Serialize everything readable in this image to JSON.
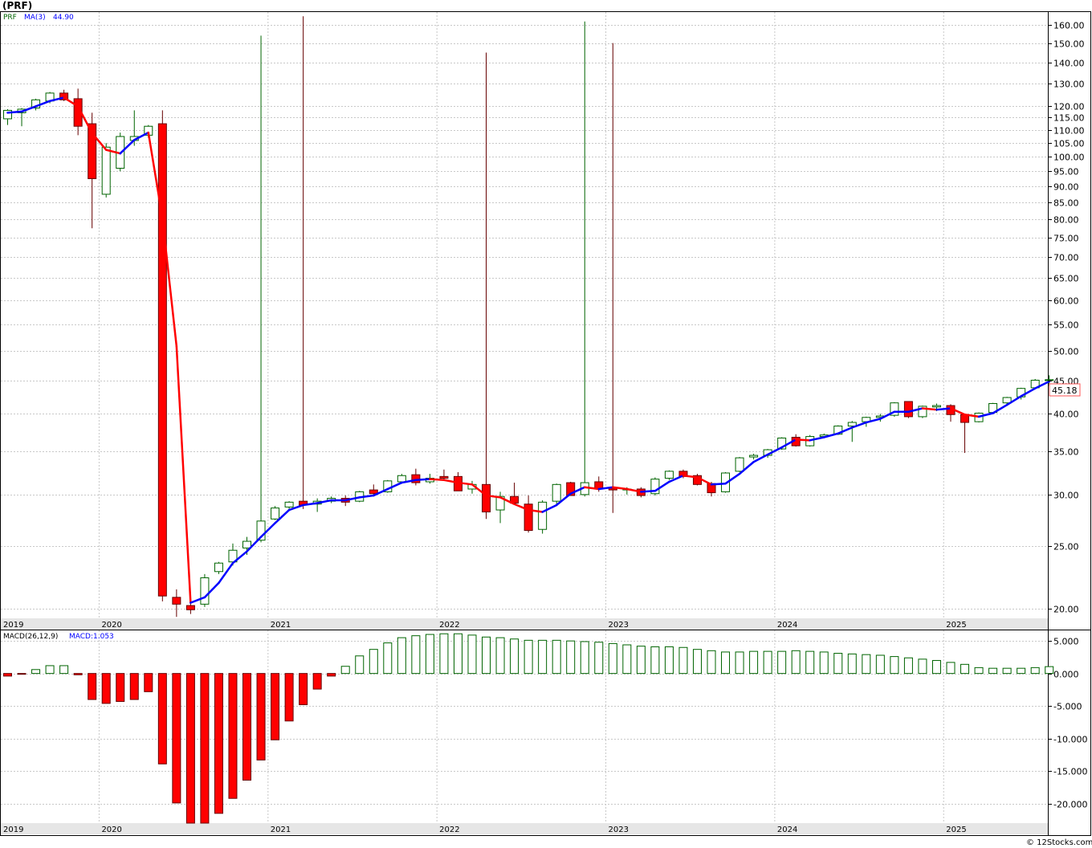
{
  "header": {
    "title": "(PRF)"
  },
  "legend": {
    "symbol": "PRF",
    "ma_label": "MA(3)",
    "ma_value": "44.90",
    "macd_label": "MACD(26,12,9)",
    "macd_value": "MACD:1.053"
  },
  "credit": "© 12Stocks.com",
  "last_price_label": "45.18",
  "colors": {
    "up": "#006400",
    "down_fill": "#ff0000",
    "down_wick": "#660000",
    "ma_up": "#0000ff",
    "ma_down": "#ff0000",
    "grid": "#c8c8c8",
    "year_band": "#e6e6e6",
    "last_box": "#ff5555"
  },
  "year_labels": [
    "2019",
    "2020",
    "2021",
    "2022",
    "2023",
    "2024",
    "2025"
  ],
  "price_ticks": [
    "160.00",
    "150.00",
    "140.00",
    "130.00",
    "120.00",
    "115.00",
    "110.00",
    "105.00",
    "100.00",
    "95.00",
    "90.00",
    "85.00",
    "80.00",
    "75.00",
    "70.00",
    "65.00",
    "60.00",
    "55.00",
    "50.00",
    "45.00",
    "40.00",
    "35.00",
    "30.00",
    "25.00",
    "20.00"
  ],
  "macd_ticks": [
    "5.000",
    "0.000",
    "-5.000",
    "-10.000",
    "-15.000",
    "-20.000"
  ],
  "chart_data": [
    {
      "type": "candlestick",
      "title": "(PRF)",
      "scale": "log",
      "ylim": [
        19.3,
        168
      ],
      "x_range": [
        "2019-06",
        "2025-11"
      ],
      "candles": [
        {
          "t": "2019-06",
          "o": 114.5,
          "h": 118.5,
          "l": 112,
          "c": 118
        },
        {
          "t": "2019-07",
          "o": 117,
          "h": 119,
          "l": 111.5,
          "c": 118.5
        },
        {
          "t": "2019-08",
          "o": 119,
          "h": 123,
          "l": 118,
          "c": 122.5
        },
        {
          "t": "2019-09",
          "o": 122,
          "h": 126,
          "l": 121,
          "c": 125.5
        },
        {
          "t": "2019-10",
          "o": 125.5,
          "h": 127,
          "l": 122,
          "c": 122.5
        },
        {
          "t": "2019-11",
          "o": 123,
          "h": 127.5,
          "l": 108,
          "c": 111.5
        },
        {
          "t": "2019-12",
          "o": 112.5,
          "h": 117,
          "l": 77.5,
          "c": 92.5
        },
        {
          "t": "2020-01",
          "o": 87.5,
          "h": 105,
          "l": 86.5,
          "c": 103.5
        },
        {
          "t": "2020-02",
          "o": 96,
          "h": 109,
          "l": 95,
          "c": 107.5
        },
        {
          "t": "2020-03",
          "o": 106,
          "h": 118,
          "l": 104,
          "c": 107.5
        },
        {
          "t": "2020-04",
          "o": 108,
          "h": 112,
          "l": 107,
          "c": 111.5
        },
        {
          "t": "2020-05",
          "o": 112.5,
          "h": 118,
          "l": 20.5,
          "c": 20.9
        },
        {
          "t": "2020-06",
          "o": 20.8,
          "h": 21.4,
          "l": 19.4,
          "c": 20.3
        },
        {
          "t": "2020-07",
          "o": 20.2,
          "h": 20.5,
          "l": 19.6,
          "c": 19.9
        },
        {
          "t": "2020-08",
          "o": 20.3,
          "h": 22.6,
          "l": 20.1,
          "c": 22.3
        },
        {
          "t": "2020-09",
          "o": 22.8,
          "h": 23.6,
          "l": 22.6,
          "c": 23.5
        },
        {
          "t": "2020-10",
          "o": 23.6,
          "h": 25.2,
          "l": 23.3,
          "c": 24.6
        },
        {
          "t": "2020-11",
          "o": 24.8,
          "h": 25.8,
          "l": 24.2,
          "c": 25.4
        },
        {
          "t": "2020-12",
          "o": 25.5,
          "h": 154,
          "l": 25.3,
          "c": 27.3
        },
        {
          "t": "2021-01",
          "o": 27.5,
          "h": 28.8,
          "l": 27.4,
          "c": 28.6
        },
        {
          "t": "2021-02",
          "o": 28.7,
          "h": 29.3,
          "l": 28.5,
          "c": 29.2
        },
        {
          "t": "2021-03",
          "o": 29.3,
          "h": 165,
          "l": 28.5,
          "c": 28.9
        },
        {
          "t": "2021-04",
          "o": 29,
          "h": 29.6,
          "l": 28.2,
          "c": 29.3
        },
        {
          "t": "2021-05",
          "o": 29.3,
          "h": 29.8,
          "l": 29.1,
          "c": 29.6
        },
        {
          "t": "2021-06",
          "o": 29.6,
          "h": 29.9,
          "l": 28.8,
          "c": 29.2
        },
        {
          "t": "2021-07",
          "o": 29.3,
          "h": 30.4,
          "l": 29.2,
          "c": 30.3
        },
        {
          "t": "2021-08",
          "o": 30.5,
          "h": 31.1,
          "l": 30,
          "c": 30.1
        },
        {
          "t": "2021-09",
          "o": 30.3,
          "h": 31.6,
          "l": 30.2,
          "c": 31.5
        },
        {
          "t": "2021-10",
          "o": 31.4,
          "h": 32.3,
          "l": 31.3,
          "c": 32.1
        },
        {
          "t": "2021-11",
          "o": 32.2,
          "h": 32.9,
          "l": 31,
          "c": 31.3
        },
        {
          "t": "2021-12",
          "o": 31.4,
          "h": 32.3,
          "l": 31.2,
          "c": 31.8
        },
        {
          "t": "2022-01",
          "o": 32,
          "h": 32.8,
          "l": 31.6,
          "c": 31.8
        },
        {
          "t": "2022-02",
          "o": 32,
          "h": 32.5,
          "l": 30.4,
          "c": 30.4
        },
        {
          "t": "2022-03",
          "o": 30.6,
          "h": 31.5,
          "l": 30.1,
          "c": 31.1
        },
        {
          "t": "2022-04",
          "o": 31.1,
          "h": 145,
          "l": 27.5,
          "c": 28.2
        },
        {
          "t": "2022-05",
          "o": 28.4,
          "h": 30.3,
          "l": 27.1,
          "c": 29.8
        },
        {
          "t": "2022-06",
          "o": 29.8,
          "h": 31.3,
          "l": 28.9,
          "c": 29.1
        },
        {
          "t": "2022-07",
          "o": 29,
          "h": 29.9,
          "l": 26.2,
          "c": 26.4
        },
        {
          "t": "2022-08",
          "o": 26.5,
          "h": 29.4,
          "l": 26.1,
          "c": 29.2
        },
        {
          "t": "2022-09",
          "o": 29.3,
          "h": 31.2,
          "l": 28.9,
          "c": 31.1
        },
        {
          "t": "2022-10",
          "o": 31.3,
          "h": 31.4,
          "l": 29.9,
          "c": 29.9
        },
        {
          "t": "2022-11",
          "o": 30,
          "h": 162,
          "l": 29.8,
          "c": 31.3
        },
        {
          "t": "2022-12",
          "o": 31.4,
          "h": 32,
          "l": 30.3,
          "c": 30.6
        },
        {
          "t": "2023-01",
          "o": 30.7,
          "h": 150,
          "l": 28.1,
          "c": 30.5
        },
        {
          "t": "2023-02",
          "o": 30.5,
          "h": 30.8,
          "l": 30,
          "c": 30.6
        },
        {
          "t": "2023-03",
          "o": 30.6,
          "h": 30.8,
          "l": 29.7,
          "c": 29.9
        },
        {
          "t": "2023-04",
          "o": 30.1,
          "h": 31.9,
          "l": 29.9,
          "c": 31.7
        },
        {
          "t": "2023-05",
          "o": 31.8,
          "h": 32.7,
          "l": 31.6,
          "c": 32.6
        },
        {
          "t": "2023-06",
          "o": 32.6,
          "h": 32.8,
          "l": 31.8,
          "c": 32
        },
        {
          "t": "2023-07",
          "o": 32.1,
          "h": 32.3,
          "l": 31,
          "c": 31.1
        },
        {
          "t": "2023-08",
          "o": 31.2,
          "h": 31.4,
          "l": 29.8,
          "c": 30.2
        },
        {
          "t": "2023-09",
          "o": 30.3,
          "h": 32.5,
          "l": 30.2,
          "c": 32.4
        },
        {
          "t": "2023-10",
          "o": 32.6,
          "h": 34.3,
          "l": 32.5,
          "c": 34.2
        },
        {
          "t": "2023-11",
          "o": 34.3,
          "h": 34.7,
          "l": 34,
          "c": 34.5
        },
        {
          "t": "2023-12",
          "o": 34.5,
          "h": 35.3,
          "l": 34.2,
          "c": 35.2
        },
        {
          "t": "2024-01",
          "o": 35.3,
          "h": 36.8,
          "l": 35.2,
          "c": 36.7
        },
        {
          "t": "2024-02",
          "o": 36.8,
          "h": 37.2,
          "l": 35.6,
          "c": 35.7
        },
        {
          "t": "2024-03",
          "o": 35.7,
          "h": 37.1,
          "l": 35.6,
          "c": 36.9
        },
        {
          "t": "2024-04",
          "o": 36.9,
          "h": 37.3,
          "l": 36.7,
          "c": 37.1
        },
        {
          "t": "2024-05",
          "o": 37.2,
          "h": 38.4,
          "l": 37.1,
          "c": 38.3
        },
        {
          "t": "2024-06",
          "o": 38.3,
          "h": 39,
          "l": 36.2,
          "c": 38.8
        },
        {
          "t": "2024-07",
          "o": 38.9,
          "h": 39.6,
          "l": 38.2,
          "c": 39.5
        },
        {
          "t": "2024-08",
          "o": 39.5,
          "h": 40,
          "l": 38.9,
          "c": 39.7
        },
        {
          "t": "2024-09",
          "o": 39.8,
          "h": 41.7,
          "l": 39.6,
          "c": 41.6
        },
        {
          "t": "2024-10",
          "o": 41.8,
          "h": 41.8,
          "l": 39.4,
          "c": 39.6
        },
        {
          "t": "2024-11",
          "o": 39.6,
          "h": 41.2,
          "l": 39.4,
          "c": 41.1
        },
        {
          "t": "2024-12",
          "o": 41,
          "h": 41.5,
          "l": 40.4,
          "c": 41.2
        },
        {
          "t": "2025-01",
          "o": 41.2,
          "h": 41.4,
          "l": 38.9,
          "c": 39.9
        },
        {
          "t": "2025-02",
          "o": 39.9,
          "h": 40,
          "l": 34.8,
          "c": 38.8
        },
        {
          "t": "2025-03",
          "o": 38.9,
          "h": 40.2,
          "l": 38.8,
          "c": 40.1
        },
        {
          "t": "2025-04",
          "o": 40.2,
          "h": 41.6,
          "l": 40.1,
          "c": 41.5
        },
        {
          "t": "2025-05",
          "o": 41.6,
          "h": 42.5,
          "l": 41.4,
          "c": 42.4
        },
        {
          "t": "2025-06",
          "o": 42.5,
          "h": 43.9,
          "l": 42.1,
          "c": 43.8
        },
        {
          "t": "2025-07",
          "o": 43.9,
          "h": 45.3,
          "l": 43.8,
          "c": 45.1
        },
        {
          "t": "2025-08",
          "o": 45.1,
          "h": 45.9,
          "l": 44.2,
          "c": 45.18
        }
      ],
      "ma3": [
        117.0,
        117.5,
        119.7,
        122.0,
        123.5,
        119.7,
        108.8,
        102.5,
        101.2,
        106.2,
        109.0,
        80.3,
        50.9,
        20.4,
        20.8,
        21.9,
        23.5,
        24.5,
        25.8,
        27.1,
        28.4,
        28.9,
        29.1,
        29.4,
        29.4,
        29.7,
        29.9,
        30.6,
        31.3,
        31.6,
        31.7,
        31.6,
        31.3,
        31.1,
        29.9,
        29.7,
        29.0,
        28.4,
        28.2,
        28.9,
        30.1,
        30.8,
        30.6,
        30.8,
        30.6,
        30.3,
        30.4,
        31.4,
        32.1,
        31.9,
        31.1,
        31.2,
        32.3,
        33.7,
        34.6,
        35.5,
        36.5,
        36.4,
        36.8,
        37.3,
        38.1,
        38.8,
        39.3,
        40.3,
        40.3,
        40.8,
        40.6,
        40.8,
        39.9,
        39.6,
        40.1,
        41.3,
        42.6,
        43.8,
        44.9
      ]
    },
    {
      "type": "bar",
      "title": "MACD(26,12,9)",
      "ylabel": "",
      "ylim": [
        -23,
        6.5
      ],
      "series": [
        {
          "name": "MACD:1.053",
          "values": [
            -0.4,
            -0.1,
            0.6,
            1.2,
            1.2,
            -0.2,
            -4.0,
            -4.6,
            -4.3,
            -4.0,
            -2.8,
            -13.9,
            -19.9,
            -23.0,
            -23.0,
            -21.5,
            -19.2,
            -16.4,
            -13.3,
            -10.2,
            -7.3,
            -4.8,
            -2.4,
            -0.4,
            1.1,
            2.7,
            3.7,
            4.7,
            5.5,
            5.8,
            6.0,
            6.1,
            6.1,
            5.9,
            5.6,
            5.5,
            5.3,
            5.1,
            5.1,
            5.1,
            5.0,
            4.9,
            4.8,
            4.6,
            4.4,
            4.2,
            4.1,
            4.1,
            4.0,
            3.7,
            3.5,
            3.3,
            3.3,
            3.4,
            3.4,
            3.4,
            3.5,
            3.4,
            3.3,
            3.1,
            3.0,
            2.9,
            2.8,
            2.6,
            2.4,
            2.2,
            2.0,
            1.7,
            1.4,
            0.9,
            0.8,
            0.8,
            0.8,
            0.9,
            1.053
          ]
        }
      ]
    }
  ]
}
